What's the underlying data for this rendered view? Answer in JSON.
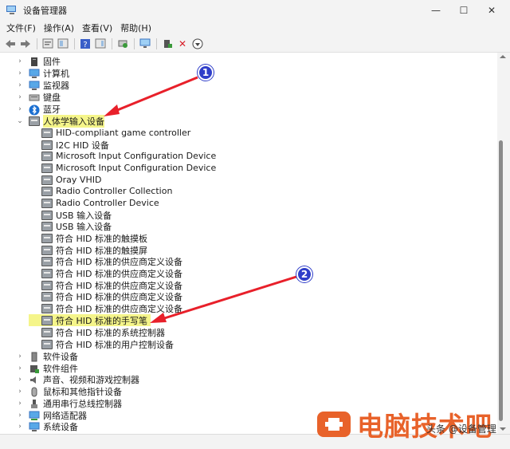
{
  "window": {
    "title": "设备管理器",
    "minimize": "—",
    "maximize": "☐",
    "close": "✕"
  },
  "menu": [
    "文件(F)",
    "操作(A)",
    "查看(V)",
    "帮助(H)"
  ],
  "toolbar": {
    "icons": [
      "back-arrow-icon",
      "forward-arrow-icon",
      "properties-icon",
      "console-tree-icon",
      "help-icon",
      "action-pane-icon",
      "scan-hardware-icon",
      "monitor-icon",
      "update-driver-icon",
      "uninstall-icon",
      "disable-device-icon"
    ],
    "delete_glyph": "✕",
    "disable_glyph": "⬇"
  },
  "tree": {
    "top_items": [
      "固件",
      "计算机",
      "监视器",
      "键盘",
      "蓝牙"
    ],
    "hid_category": "人体学输入设备",
    "hid_children": [
      "HID-compliant game controller",
      "I2C HID 设备",
      "Microsoft Input Configuration Device",
      "Microsoft Input Configuration Device",
      "Oray VHID",
      "Radio Controller Collection",
      "Radio Controller Device",
      "USB 输入设备",
      "USB 输入设备",
      "符合 HID 标准的触摸板",
      "符合 HID 标准的触摸屏",
      "符合 HID 标准的供应商定义设备",
      "符合 HID 标准的供应商定义设备",
      "符合 HID 标准的供应商定义设备",
      "符合 HID 标准的供应商定义设备",
      "符合 HID 标准的供应商定义设备",
      "符合 HID 标准的手写笔",
      "符合 HID 标准的系统控制器",
      "符合 HID 标准的用户控制设备"
    ],
    "bottom_items": [
      "软件设备",
      "软件组件",
      "声音、视频和游戏控制器",
      "鼠标和其他指针设备",
      "通用串行总线控制器",
      "网络适配器",
      "系统设备"
    ],
    "chevron_collapsed": "›",
    "chevron_expanded": "⌄"
  },
  "annotations": {
    "badge1": "1",
    "badge2": "2",
    "highlight_color": "#f5f58a",
    "arrow_color": "#e8202a"
  },
  "watermark": {
    "text": "电脑技术吧",
    "sub": "头条 @设备管理",
    "color": "#e8622a"
  }
}
